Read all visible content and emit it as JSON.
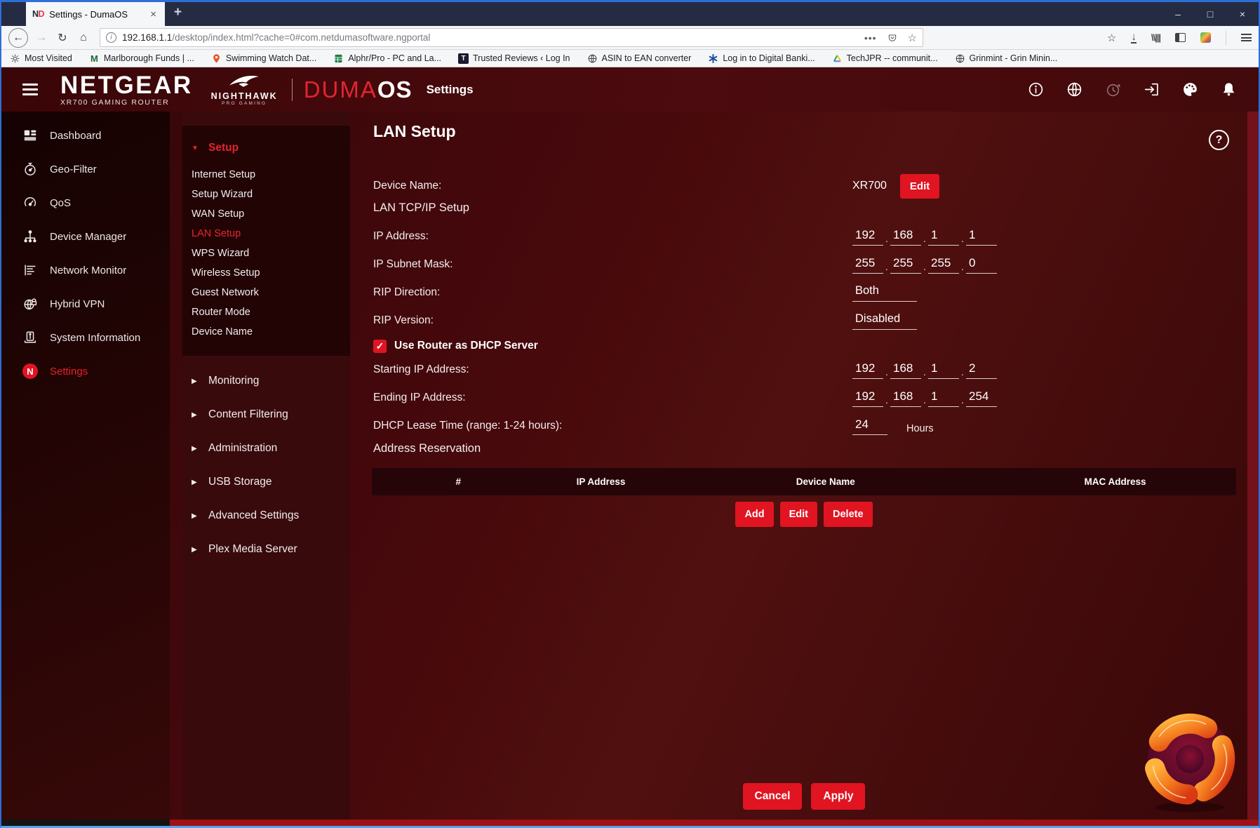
{
  "browser": {
    "tab_title": "Settings - DumaOS",
    "favicon_n": "N",
    "favicon_d": "D",
    "close_tab": "×",
    "new_tab": "+",
    "window_min": "–",
    "window_max": "□",
    "window_close": "×",
    "back": "←",
    "forward": "→",
    "reload": "↻",
    "home": "⌂",
    "url_host": "192.168.1.1",
    "url_path": "/desktop/index.html?cache=0#com.netdumasoftware.ngportal",
    "info_glyph": "i",
    "page_actions": "•••",
    "star": "☆",
    "bookmark_star": "☆",
    "download": "↓",
    "library": "\\\\|||",
    "bookmarks": [
      {
        "label": "Most Visited",
        "icon": "gear"
      },
      {
        "label": "Marlborough Funds | ...",
        "icon": "gmail-m"
      },
      {
        "label": "Swimming Watch Dat...",
        "icon": "map-pin"
      },
      {
        "label": "Alphr/Pro - PC and La...",
        "icon": "spreadsheet"
      },
      {
        "label": "Trusted Reviews ‹ Log In",
        "icon": "t-square"
      },
      {
        "label": "ASIN to EAN converter",
        "icon": "globe"
      },
      {
        "label": "Log in to Digital Banki...",
        "icon": "blue-burst"
      },
      {
        "label": "TechJPR -- communit...",
        "icon": "drive-triangle"
      },
      {
        "label": "Grinmint - Grin Minin...",
        "icon": "globe"
      }
    ],
    "t_letter": "T",
    "m_letter": "M"
  },
  "header": {
    "brand": "NETGEAR",
    "model": "XR700 GAMING ROUTER",
    "nighthawk": "NIGHTHAWK",
    "nighthawk_sub": "PRO GAMING",
    "duma": "DUMA",
    "os": "OS",
    "page": "Settings"
  },
  "sidebar": {
    "items": [
      {
        "label": "Dashboard"
      },
      {
        "label": "Geo-Filter"
      },
      {
        "label": "QoS"
      },
      {
        "label": "Device Manager"
      },
      {
        "label": "Network Monitor"
      },
      {
        "label": "Hybrid VPN"
      },
      {
        "label": "System Information"
      },
      {
        "label": "Settings",
        "active": true
      }
    ],
    "n_badge": "N"
  },
  "submenu": {
    "open_triangle": "▼",
    "closed_triangle": "▶",
    "setup": {
      "label": "Setup",
      "items": [
        {
          "label": "Internet Setup"
        },
        {
          "label": "Setup Wizard"
        },
        {
          "label": "WAN Setup"
        },
        {
          "label": "LAN Setup",
          "active": true
        },
        {
          "label": "WPS Wizard"
        },
        {
          "label": "Wireless Setup"
        },
        {
          "label": "Guest Network"
        },
        {
          "label": "Router Mode"
        },
        {
          "label": "Device Name"
        }
      ]
    },
    "groups": [
      {
        "label": "Monitoring"
      },
      {
        "label": "Content Filtering"
      },
      {
        "label": "Administration"
      },
      {
        "label": "USB Storage"
      },
      {
        "label": "Advanced Settings"
      },
      {
        "label": "Plex Media Server"
      }
    ]
  },
  "main": {
    "title": "LAN Setup",
    "help": "?",
    "device_name_label": "Device Name:",
    "device_name_value": "XR700",
    "edit_button": "Edit",
    "tcpip_header": "LAN TCP/IP Setup",
    "ip_label": "IP Address:",
    "ip": [
      "192",
      "168",
      "1",
      "1"
    ],
    "subnet_label": "IP Subnet Mask:",
    "subnet": [
      "255",
      "255",
      "255",
      "0"
    ],
    "rip_direction_label": "RIP Direction:",
    "rip_direction": "Both",
    "rip_version_label": "RIP Version:",
    "rip_version": "Disabled",
    "octet_separator": ".",
    "dhcp_checkbox_label": "Use Router as DHCP Server",
    "checkmark": "✓",
    "start_label": "Starting IP Address:",
    "start_ip": [
      "192",
      "168",
      "1",
      "2"
    ],
    "end_label": "Ending IP Address:",
    "end_ip": [
      "192",
      "168",
      "1",
      "254"
    ],
    "lease_label": "DHCP Lease Time (range: 1-24 hours):",
    "lease_value": "24",
    "lease_unit": "Hours",
    "reservation_header": "Address Reservation",
    "table_columns": [
      "#",
      "IP Address",
      "Device Name",
      "MAC Address"
    ],
    "table_rows": [],
    "add_button": "Add",
    "edit_row_button": "Edit",
    "delete_button": "Delete",
    "cancel_button": "Cancel",
    "apply_button": "Apply"
  },
  "colors": {
    "accent_red": "#e11422",
    "header_maroon": "#4c0b0e",
    "tabbar_navy": "#242b43",
    "content_maroon": "#48090c"
  }
}
